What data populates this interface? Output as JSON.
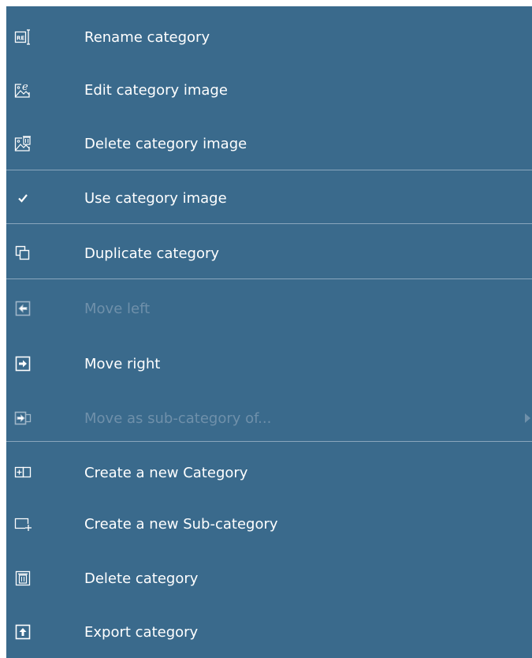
{
  "menu": {
    "items": [
      {
        "label": "Rename category",
        "icon": "rename-icon",
        "enabled": true
      },
      {
        "label": "Edit category image",
        "icon": "edit-image-icon",
        "enabled": true
      },
      {
        "label": "Delete category image",
        "icon": "delete-image-icon",
        "enabled": true
      },
      {
        "label": "Use category image",
        "icon": "checkmark-icon",
        "enabled": true,
        "checked": true
      },
      {
        "label": "Duplicate category",
        "icon": "duplicate-icon",
        "enabled": true
      },
      {
        "label": "Move left",
        "icon": "move-left-icon",
        "enabled": false
      },
      {
        "label": "Move right",
        "icon": "move-right-icon",
        "enabled": true
      },
      {
        "label": "Move as sub-category of...",
        "icon": "move-subcategory-icon",
        "enabled": false,
        "has_submenu": true
      },
      {
        "label": "Create a new Category",
        "icon": "new-category-icon",
        "enabled": true
      },
      {
        "label": "Create a new Sub-category",
        "icon": "new-subcategory-icon",
        "enabled": true
      },
      {
        "label": "Delete category",
        "icon": "delete-category-icon",
        "enabled": true
      },
      {
        "label": "Export category",
        "icon": "export-icon",
        "enabled": true
      }
    ]
  },
  "colors": {
    "menu_background": "#3a6a8c",
    "text": "#ffffff",
    "disabled_text": "#6f90aa",
    "separator": "#8aa6bd"
  }
}
